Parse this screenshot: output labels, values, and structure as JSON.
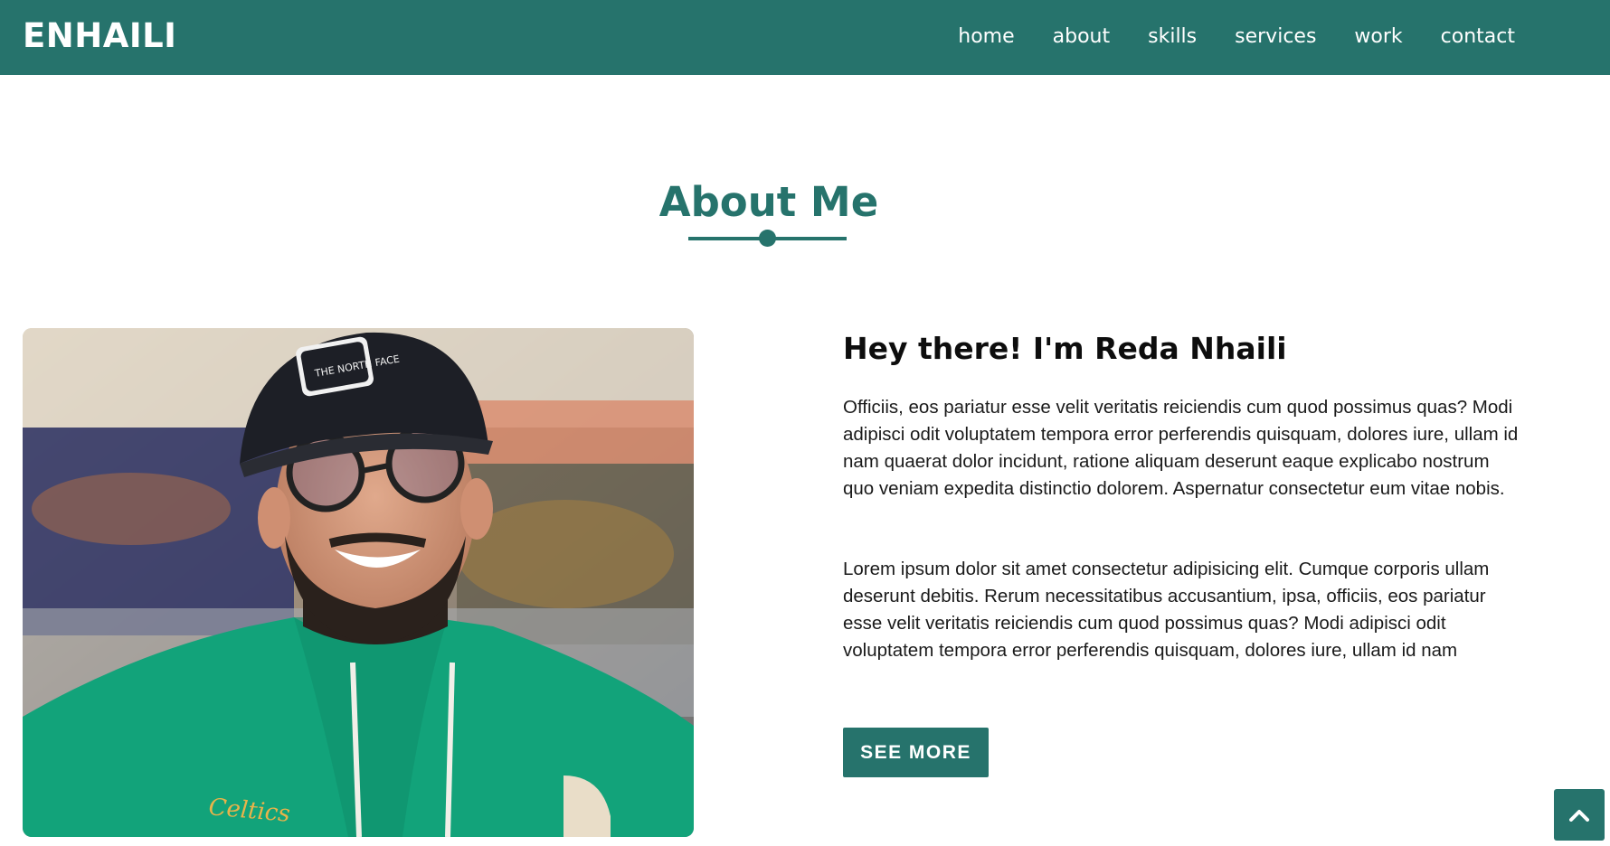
{
  "nav": {
    "brand": "ENHAILI",
    "links": [
      "home",
      "about",
      "skills",
      "services",
      "work",
      "contact"
    ]
  },
  "about": {
    "title": "About Me",
    "headline": "Hey there! I'm Reda Nhaili",
    "paragraphs": [
      "Officiis, eos pariatur esse velit veritatis reiciendis cum quod possimus quas? Modi adipisci odit voluptatem tempora error perferendis quisquam, dolores iure, ullam id nam quaerat dolor incidunt, ratione aliquam deserunt eaque explicabo nostrum quo veniam expedita distinctio dolorem. Aspernatur consectetur eum vitae nobis.",
      "Lorem ipsum dolor sit amet consectetur adipisicing elit. Cumque corporis ullam deserunt debitis. Rerum necessitatibus accusantium, ipsa, officiis, eos pariatur esse velit veritatis reiciendis cum quod possimus quas? Modi adipisci odit voluptatem tempora error perferendis quisquam, dolores iure, ullam id nam"
    ],
    "button_label": "SEE MORE"
  },
  "photo": {
    "cap_text": "THE NORTH FACE",
    "hoodie_text": "Celtics"
  },
  "icons": {
    "scroll_top": "chevron-up-icon"
  },
  "colors": {
    "accent": "#26736c",
    "hoodie": "#12a37a"
  }
}
